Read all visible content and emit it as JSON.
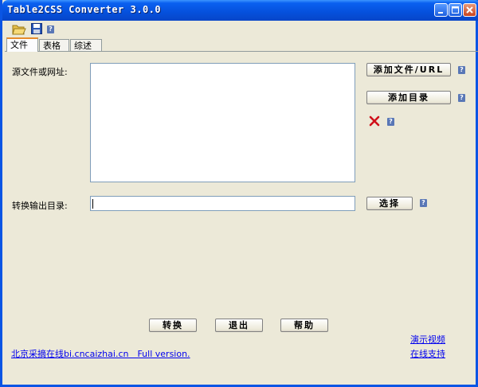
{
  "window": {
    "title": "Table2CSS Converter 3.0.0"
  },
  "toolbar": {
    "open_icon": "folder-open-icon",
    "save_icon": "floppy-save-icon",
    "help_icon": "help-icon"
  },
  "tabs": [
    {
      "label": "文件",
      "active": true
    },
    {
      "label": "表格",
      "active": false
    },
    {
      "label": "综述",
      "active": false
    }
  ],
  "file_tab": {
    "source_label": "源文件或网址:",
    "output_label": "转换输出目录:",
    "output_value": "",
    "add_file_button": "添加文件/URL",
    "add_dir_button": "添加目录",
    "remove_icon": "red-x-delete-icon",
    "choose_button": "选择",
    "help_mark": "?"
  },
  "bottom": {
    "convert_button": "转换",
    "exit_button": "退出",
    "help_button": "帮助",
    "footer_link": "北京采摘在线bi.cncaizhai.cn　Full version.",
    "demo_link": "演示视频",
    "support_link": "在线支持"
  }
}
